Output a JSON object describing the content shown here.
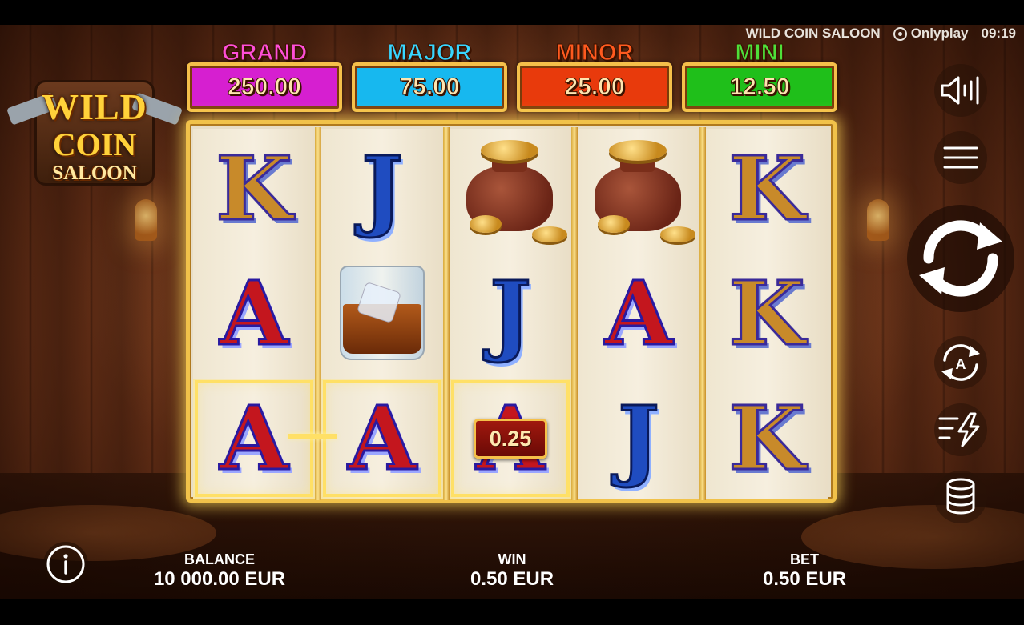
{
  "status_bar": {
    "game_title": "WILD COIN SALOON",
    "provider": "Onlyplay",
    "time": "09:19"
  },
  "logo": {
    "line1": "WILD",
    "line2": "COIN",
    "line3": "SALOON"
  },
  "jackpots": [
    {
      "label": "GRAND",
      "value": "250.00",
      "label_color": "#ff4fd8",
      "box_color": "#d61fd0"
    },
    {
      "label": "MAJOR",
      "value": "75.00",
      "label_color": "#38d6ff",
      "box_color": "#17b8ef"
    },
    {
      "label": "MINOR",
      "value": "25.00",
      "label_color": "#ff5a1f",
      "box_color": "#e83a0c"
    },
    {
      "label": "MINI",
      "value": "12.50",
      "label_color": "#4ee03a",
      "box_color": "#1fbf1a"
    }
  ],
  "reels": [
    [
      "K",
      "A",
      "A"
    ],
    [
      "J",
      "whisky-glass",
      "A"
    ],
    [
      "coin-bag",
      "J",
      "A"
    ],
    [
      "coin-bag",
      "A",
      "J"
    ],
    [
      "K",
      "K",
      "K"
    ]
  ],
  "winning_cells": [
    [
      0,
      2
    ],
    [
      1,
      2
    ],
    [
      2,
      2
    ]
  ],
  "win_badge": "0.25",
  "footer": {
    "balance_label": "BALANCE",
    "balance_value": "10 000.00 EUR",
    "win_label": "WIN",
    "win_value": "0.50 EUR",
    "bet_label": "BET",
    "bet_value": "0.50 EUR"
  },
  "icons": {
    "sound": "speaker-icon",
    "menu": "hamburger-menu-icon",
    "spin": "spin-arrows-icon",
    "autoplay": "autoplay-icon",
    "turbo": "turbo-icon",
    "bet": "coin-stack-icon",
    "info": "info-icon"
  },
  "colors": {
    "frame_gold": "#f1c24a",
    "reel_bg": "#efe6d0",
    "win_highlight": "#ffe066"
  }
}
